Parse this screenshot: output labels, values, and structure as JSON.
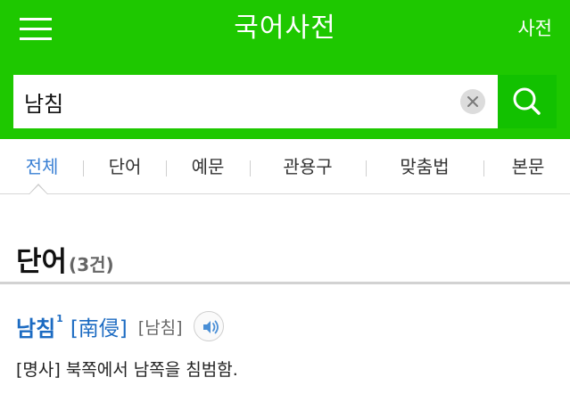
{
  "header": {
    "title": "국어사전",
    "dict_link": "사전"
  },
  "search": {
    "query": "남침"
  },
  "tabs": [
    {
      "label": "전체",
      "active": true
    },
    {
      "label": "단어",
      "active": false
    },
    {
      "label": "예문",
      "active": false
    },
    {
      "label": "관용구",
      "active": false
    },
    {
      "label": "맞춤법",
      "active": false
    },
    {
      "label": "본문",
      "active": false
    }
  ],
  "section": {
    "title": "단어",
    "count": "(3건)"
  },
  "entry": {
    "word": "남침",
    "superscript": "1",
    "hanja": "[南侵]",
    "pronunciation": "[남침]",
    "definition": "[명사] 북쪽에서 남쪽을 침범함."
  },
  "colors": {
    "brand_green": "#1ec800",
    "search_button_green": "#12c100",
    "active_tab_blue": "#3a80d4",
    "entry_blue": "#1c6bc2"
  },
  "icons": [
    "hamburger-menu-icon",
    "clear-icon",
    "search-icon",
    "speaker-icon"
  ]
}
